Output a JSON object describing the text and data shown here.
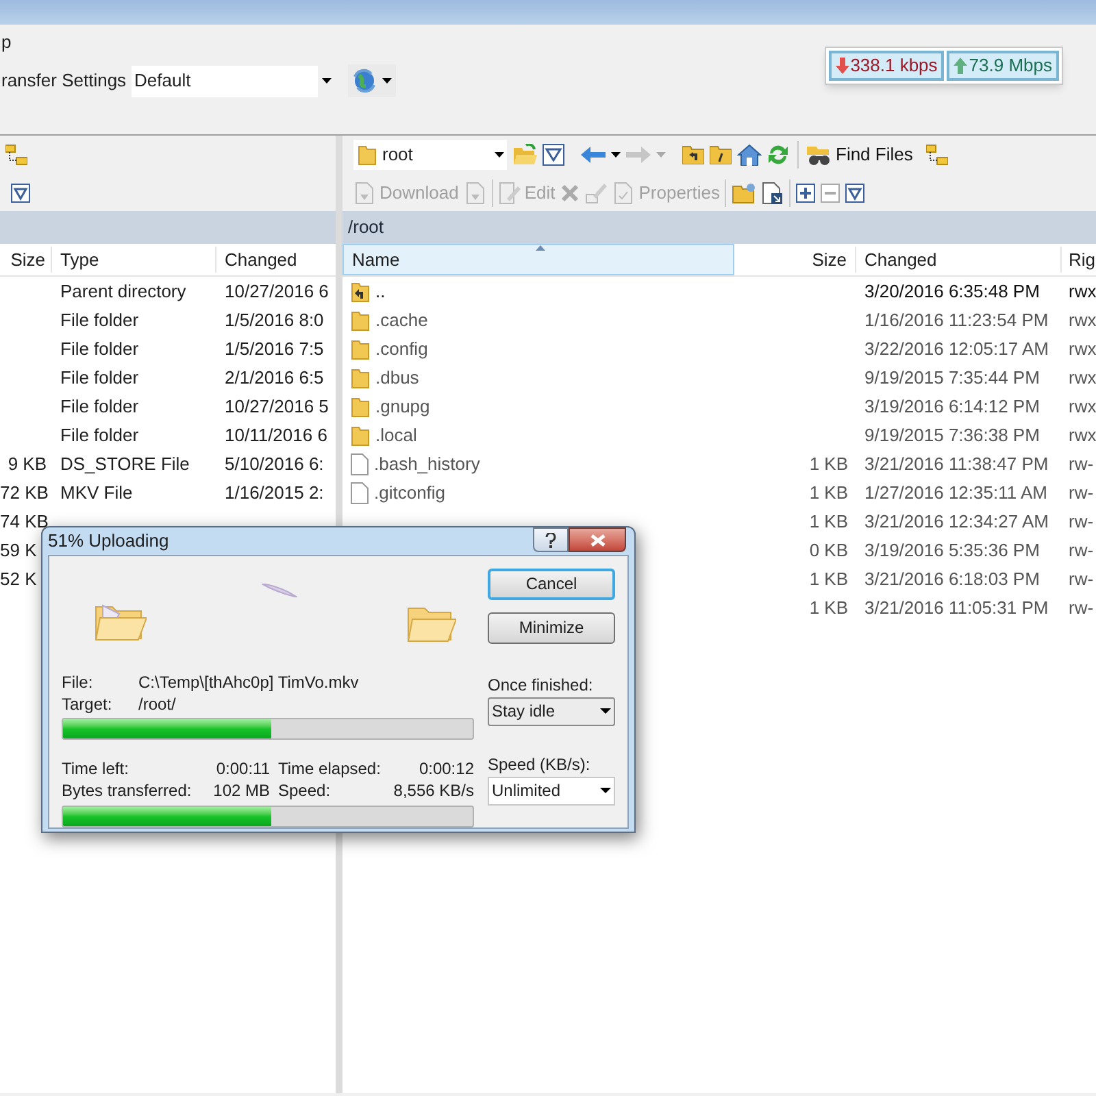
{
  "menu_fragment": "p",
  "transfer_settings": {
    "label": "ransfer Settings",
    "value": "Default"
  },
  "speed_meter": {
    "download": "338.1 kbps",
    "upload": "73.9 Mbps"
  },
  "left_panel": {
    "columns": [
      "Size",
      "Type",
      "Changed"
    ],
    "rows": [
      {
        "type": "Parent directory",
        "changed": "10/27/2016  6"
      },
      {
        "type": "File folder",
        "changed": "1/5/2016  8:0"
      },
      {
        "type": "File folder",
        "changed": "1/5/2016  7:5"
      },
      {
        "type": "File folder",
        "changed": "2/1/2016  6:5"
      },
      {
        "type": "File folder",
        "changed": "10/27/2016  5"
      },
      {
        "type": "File folder",
        "changed": "10/11/2016  6"
      },
      {
        "size": "9 KB",
        "type": "DS_STORE File",
        "changed": "5/10/2016  6:"
      },
      {
        "size": "72 KB",
        "type": "MKV File",
        "changed": "1/16/2015  2:"
      },
      {
        "size": "74 KB"
      },
      {
        "size": "59 K"
      },
      {
        "size": "52 K"
      }
    ]
  },
  "right_panel": {
    "location": "root",
    "toolbar": [
      {
        "label": "Find Files",
        "disabled": false
      }
    ],
    "toolbar_2": [
      {
        "label": "Download",
        "disabled": true
      },
      {
        "label": "Edit",
        "disabled": true
      },
      {
        "label": "Properties",
        "disabled": true
      }
    ],
    "path": "/root",
    "columns": [
      "Name",
      "Size",
      "Changed",
      "Rig"
    ],
    "rows": [
      {
        "kind": "parent",
        "name": "..",
        "changed": "3/20/2016 6:35:48 PM",
        "rights": "rwx"
      },
      {
        "kind": "folder",
        "name": ".cache",
        "changed": "1/16/2016 11:23:54 PM",
        "rights": "rwx"
      },
      {
        "kind": "folder",
        "name": ".config",
        "changed": "3/22/2016 12:05:17 AM",
        "rights": "rwx"
      },
      {
        "kind": "folder",
        "name": ".dbus",
        "changed": "9/19/2015 7:35:44 PM",
        "rights": "rwx"
      },
      {
        "kind": "folder",
        "name": ".gnupg",
        "changed": "3/19/2016 6:14:12 PM",
        "rights": "rwx"
      },
      {
        "kind": "folder",
        "name": ".local",
        "changed": "9/19/2015 7:36:38 PM",
        "rights": "rwx"
      },
      {
        "kind": "file",
        "name": ".bash_history",
        "size": "1 KB",
        "changed": "3/21/2016 11:38:47 PM",
        "rights": "rw-"
      },
      {
        "kind": "file",
        "name": ".gitconfig",
        "size": "1 KB",
        "changed": "1/27/2016 12:35:11 AM",
        "rights": "rw-"
      },
      {
        "kind": "hidden",
        "size": "1 KB",
        "changed": "3/21/2016 12:34:27 AM",
        "rights": "rw-"
      },
      {
        "kind": "hidden",
        "size": "0 KB",
        "changed": "3/19/2016 5:35:36 PM",
        "rights": "rw-"
      },
      {
        "kind": "hidden",
        "size": "1 KB",
        "changed": "3/21/2016 6:18:03 PM",
        "rights": "rw-"
      },
      {
        "kind": "hidden",
        "size": "1 KB",
        "changed": "3/21/2016 11:05:31 PM",
        "rights": "rw-"
      }
    ]
  },
  "dialog": {
    "title": "51% Uploading",
    "file_label": "File:",
    "file": "C:\\Temp\\[thAhc0p] TimVo.mkv",
    "target_label": "Target:",
    "target": "/root/",
    "file_progress": {
      "level": 0.51
    },
    "stats": [
      {
        "label": "Time left:",
        "value": "0:00:11"
      },
      {
        "label": "Time elapsed:",
        "value": "0:00:12"
      },
      {
        "label": "Bytes transferred:",
        "value": "102 MB"
      },
      {
        "label": "Speed:",
        "value": "8,556 KB/s"
      }
    ],
    "total_progress": {
      "level": 0.51
    },
    "buttons": [
      {
        "label": "Cancel",
        "selected": true
      },
      {
        "label": "Minimize",
        "selected": false
      }
    ],
    "once_finished": {
      "label": "Once finished:",
      "value": "Stay idle"
    },
    "speed_limit": {
      "label": "Speed (KB/s):",
      "value": "Unlimited"
    }
  }
}
